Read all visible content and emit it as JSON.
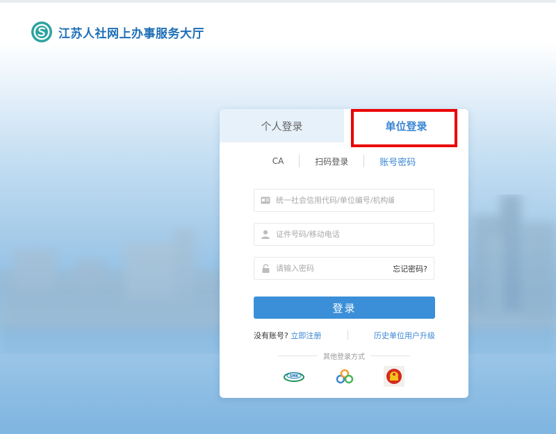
{
  "site": {
    "title": "江苏人社网上办事服务大厅",
    "logo_icon": "jiangsu-hrss-logo-icon",
    "brand_color": "#1e6fb6"
  },
  "tabs": [
    {
      "label": "个人登录",
      "active": false
    },
    {
      "label": "单位登录",
      "active": true
    }
  ],
  "subtabs": [
    {
      "label": "CA",
      "active": false
    },
    {
      "label": "扫码登录",
      "active": false
    },
    {
      "label": "账号密码",
      "active": true
    }
  ],
  "form": {
    "org_code_placeholder": "统一社会信用代码/单位编号/机构编号",
    "org_code_value": "",
    "id_placeholder": "证件号码/移动电话",
    "id_value": "",
    "password_placeholder": "请输入密码",
    "password_value": "",
    "forgot_label": "忘记密码?",
    "submit_label": "登录"
  },
  "links": {
    "no_account_label": "没有账号?",
    "register_label": "立即注册",
    "upgrade_label": "历史单位用户升级"
  },
  "other_login": {
    "label": "其他登录方式",
    "options": [
      "jiangsu-smartcard-icon",
      "wechat-style-rings-icon",
      "national-emblem-icon"
    ]
  },
  "colors": {
    "accent": "#3a8fd8",
    "highlight": "#ea0000"
  }
}
